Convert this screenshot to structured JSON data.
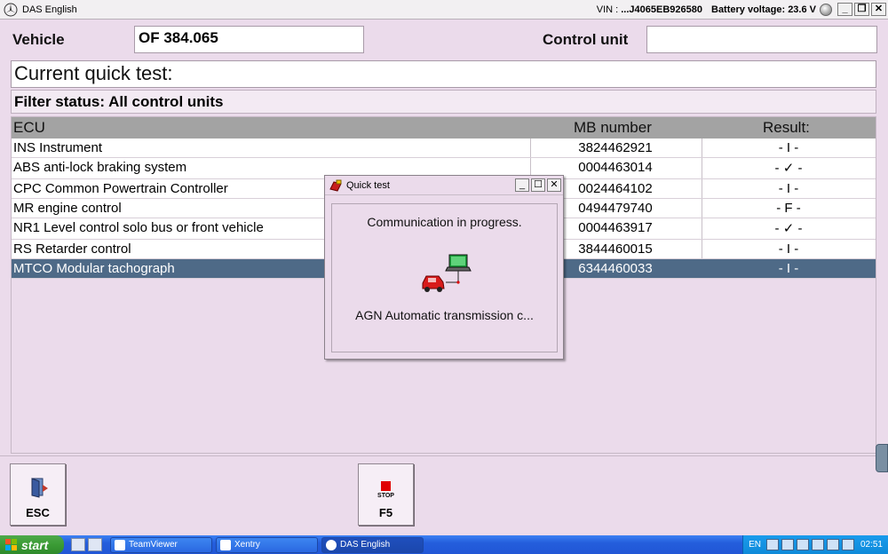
{
  "titlebar": {
    "title": "DAS English",
    "vin_label": "VIN : ",
    "vin_value": "...J4065EB926580",
    "battery": "Battery voltage: 23.6 V"
  },
  "vehicle": {
    "label": "Vehicle",
    "value": "OF 384.065",
    "control_unit_label": "Control unit",
    "control_unit_value": ""
  },
  "quick_test": {
    "label": "Current quick test:"
  },
  "filter": {
    "label": "Filter status: All control units"
  },
  "table": {
    "headers": [
      "ECU",
      "MB number",
      "Result:"
    ],
    "rows": [
      {
        "ecu": "INS Instrument",
        "mb": "3824462921",
        "result": "- I -"
      },
      {
        "ecu": "ABS anti-lock braking system",
        "mb": "0004463014",
        "result": "- ✓ -"
      },
      {
        "ecu": "CPC Common Powertrain Controller",
        "mb": "0024464102",
        "result": "- I -"
      },
      {
        "ecu": "MR engine control",
        "mb": "0494479740",
        "result": "- F -"
      },
      {
        "ecu": "NR1 Level control solo bus or front vehicle",
        "mb": "0004463917",
        "result": "- ✓ -"
      },
      {
        "ecu": "RS Retarder control",
        "mb": "3844460015",
        "result": "- I -"
      },
      {
        "ecu": "MTCO Modular tachograph",
        "mb": "6344460033",
        "result": "- I -"
      }
    ]
  },
  "buttons": {
    "esc": "ESC",
    "f5": "F5",
    "stop_text": "STOP"
  },
  "dialog": {
    "title": "Quick test",
    "message": "Communication in progress.",
    "current": "AGN Automatic transmission c..."
  },
  "taskbar": {
    "start": "start",
    "tasks": [
      "TeamViewer",
      "Xentry",
      "DAS English"
    ],
    "lang": "EN",
    "clock": "02:51"
  }
}
